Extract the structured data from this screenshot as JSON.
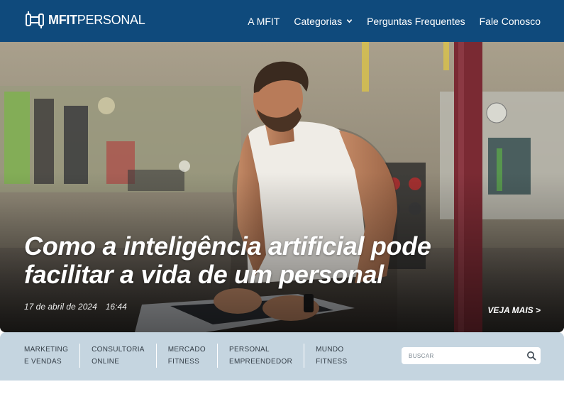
{
  "header": {
    "logo": {
      "bold": "MFIT",
      "light": "PERSONAL"
    },
    "nav": [
      {
        "label": "A MFIT"
      },
      {
        "label": "Categorias",
        "has_dropdown": true
      },
      {
        "label": "Perguntas Frequentes"
      },
      {
        "label": "Fale Conosco"
      }
    ]
  },
  "hero": {
    "title": "Como a inteligência artificial pode facilitar a vida de um personal",
    "date": "17 de abril de 2024",
    "time": "16:44",
    "more_label": "VEJA MAIS >"
  },
  "categories": [
    {
      "label": "MARKETING\nE VENDAS"
    },
    {
      "label": "CONSULTORIA\nONLINE"
    },
    {
      "label": "MERCADO\nFITNESS"
    },
    {
      "label": "PERSONAL\nEMPREENDEDOR"
    },
    {
      "label": "MUNDO\nFITNESS"
    }
  ],
  "search": {
    "placeholder": "BUSCAR"
  },
  "colors": {
    "header": "#0f4a7c",
    "category_bar": "#c5d5e0",
    "text_light": "#ffffff"
  }
}
